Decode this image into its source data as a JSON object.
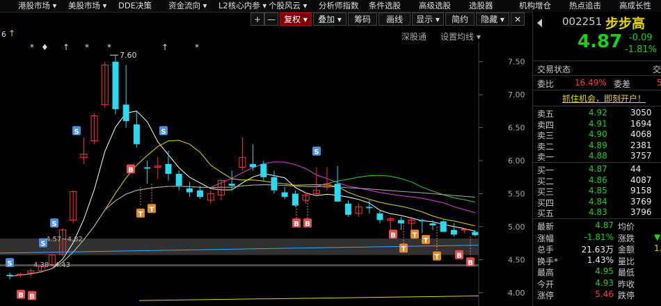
{
  "top_menu": [
    "港股市场 ▾",
    "美股市场 ▾",
    "DDE决策",
    "资金流向 ▾",
    "L2核心内参 ▾",
    "个股风云 ▾",
    "分析师指数",
    "条件选股",
    "高级选股",
    "选股器",
    "机构增仓",
    "热点追击",
    "高成长性"
  ],
  "corner_marks": {
    "left_six": "6",
    "arrow": "↑"
  },
  "toolbar": {
    "plus": "+",
    "minus": "—",
    "fuquan": "复权 ▾",
    "diejia": "叠加 ▾",
    "chouma": "筹码",
    "huaxian": "画线",
    "xianshi": "显示 ▾",
    "jianyue": "简约",
    "yincang": "隐藏 ▾",
    "close": "✕"
  },
  "subtoolbar": {
    "shengu": "深股通",
    "ma_setting": "设置均线 ▾"
  },
  "chart": {
    "y_ticks": [
      "7.50",
      "7.00",
      "6.50",
      "6.00",
      "5.50",
      "5.00",
      "4.50",
      "4.00"
    ],
    "peak_label": "7.60",
    "range_label_1": "4.57~4.82",
    "range_label_2": "4.38~4.43",
    "star_mark": "*",
    "diamond_mark": "♦",
    "arrow_mark": "↑",
    "sig_S": "S",
    "sig_B": "B",
    "sig_T": "T"
  },
  "chart_data": {
    "type": "candlestick",
    "y_range": [
      3.85,
      7.75
    ],
    "candles": [
      {
        "o": 4.27,
        "h": 4.3,
        "l": 4.2,
        "c": 4.25
      },
      {
        "o": 4.27,
        "h": 4.31,
        "l": 4.23,
        "c": 4.28
      },
      {
        "o": 4.3,
        "h": 4.36,
        "l": 4.25,
        "c": 4.33
      },
      {
        "o": 4.33,
        "h": 4.42,
        "l": 4.3,
        "c": 4.4
      },
      {
        "o": 4.42,
        "h": 4.58,
        "l": 4.4,
        "c": 4.57
      },
      {
        "o": 4.58,
        "h": 4.98,
        "l": 4.55,
        "c": 4.95
      },
      {
        "o": 5.1,
        "h": 5.55,
        "l": 5.05,
        "c": 5.53
      },
      {
        "o": 6.05,
        "h": 6.35,
        "l": 5.95,
        "c": 6.1
      },
      {
        "o": 6.3,
        "h": 6.72,
        "l": 6.25,
        "c": 6.68
      },
      {
        "o": 6.85,
        "h": 7.5,
        "l": 6.8,
        "c": 7.45
      },
      {
        "o": 7.5,
        "h": 7.6,
        "l": 6.7,
        "c": 6.78
      },
      {
        "o": 6.85,
        "h": 7.45,
        "l": 6.5,
        "c": 6.6
      },
      {
        "o": 6.55,
        "h": 6.75,
        "l": 6.2,
        "c": 6.25
      },
      {
        "o": 5.9,
        "h": 6.0,
        "l": 5.65,
        "c": 5.88
      },
      {
        "o": 5.9,
        "h": 6.05,
        "l": 5.72,
        "c": 5.92
      },
      {
        "o": 5.95,
        "h": 6.15,
        "l": 5.7,
        "c": 5.8
      },
      {
        "o": 5.8,
        "h": 5.85,
        "l": 5.55,
        "c": 5.62
      },
      {
        "o": 5.58,
        "h": 5.68,
        "l": 5.45,
        "c": 5.52
      },
      {
        "o": 5.55,
        "h": 5.62,
        "l": 5.42,
        "c": 5.45
      },
      {
        "o": 5.4,
        "h": 5.55,
        "l": 5.35,
        "c": 5.5
      },
      {
        "o": 5.48,
        "h": 5.72,
        "l": 5.4,
        "c": 5.7
      },
      {
        "o": 5.65,
        "h": 5.85,
        "l": 5.55,
        "c": 5.62
      },
      {
        "o": 5.9,
        "h": 6.35,
        "l": 5.85,
        "c": 6.05
      },
      {
        "o": 5.95,
        "h": 6.25,
        "l": 5.85,
        "c": 5.9
      },
      {
        "o": 5.95,
        "h": 6.0,
        "l": 5.7,
        "c": 5.75
      },
      {
        "o": 5.75,
        "h": 5.85,
        "l": 5.5,
        "c": 5.55
      },
      {
        "o": 5.52,
        "h": 5.6,
        "l": 5.42,
        "c": 5.45
      },
      {
        "o": 5.5,
        "h": 5.55,
        "l": 5.3,
        "c": 5.32
      },
      {
        "o": 5.4,
        "h": 5.52,
        "l": 5.35,
        "c": 5.48
      },
      {
        "o": 5.5,
        "h": 5.9,
        "l": 5.48,
        "c": 5.55
      },
      {
        "o": 5.6,
        "h": 5.9,
        "l": 5.55,
        "c": 5.65
      },
      {
        "o": 5.65,
        "h": 5.92,
        "l": 5.4,
        "c": 5.38
      },
      {
        "o": 5.35,
        "h": 5.4,
        "l": 5.15,
        "c": 5.18
      },
      {
        "o": 5.2,
        "h": 5.35,
        "l": 5.15,
        "c": 5.3
      },
      {
        "o": 5.3,
        "h": 5.4,
        "l": 5.2,
        "c": 5.28
      },
      {
        "o": 5.2,
        "h": 5.25,
        "l": 5.05,
        "c": 5.1
      },
      {
        "o": 5.1,
        "h": 5.15,
        "l": 4.9,
        "c": 5.12
      },
      {
        "o": 5.1,
        "h": 5.15,
        "l": 4.95,
        "c": 5.05
      },
      {
        "o": 5.05,
        "h": 5.15,
        "l": 4.95,
        "c": 5.1
      },
      {
        "o": 5.1,
        "h": 5.12,
        "l": 4.9,
        "c": 5.08
      },
      {
        "o": 5.05,
        "h": 5.1,
        "l": 4.95,
        "c": 5.02
      },
      {
        "o": 5.08,
        "h": 5.1,
        "l": 4.95,
        "c": 4.92
      },
      {
        "o": 4.95,
        "h": 5.05,
        "l": 4.85,
        "c": 4.88
      },
      {
        "o": 4.95,
        "h": 4.98,
        "l": 4.9,
        "c": 4.96
      },
      {
        "o": 4.92,
        "h": 4.95,
        "l": 4.85,
        "c": 4.87
      }
    ]
  },
  "quote": {
    "code": "002251",
    "name": "步步高",
    "price": "4.87",
    "change": "-0.09",
    "change_pct": "-1.81%",
    "trade_status_label": "交易状态",
    "trade_status_right": "交",
    "weibi_label": "委比",
    "weibi_value": "16.49%",
    "weicha_label": "委差",
    "weicha_value": "5",
    "promo": "抓住机会，即刻开户！"
  },
  "order_book": {
    "asks": [
      {
        "label": "卖五",
        "price": "4.92",
        "vol": "3050"
      },
      {
        "label": "卖四",
        "price": "4.91",
        "vol": "1694"
      },
      {
        "label": "卖三",
        "price": "4.90",
        "vol": "4068"
      },
      {
        "label": "卖二",
        "price": "4.89",
        "vol": "2381"
      },
      {
        "label": "卖一",
        "price": "4.88",
        "vol": "3757"
      }
    ],
    "bids": [
      {
        "label": "买一",
        "price": "4.87",
        "vol": "44"
      },
      {
        "label": "买二",
        "price": "4.86",
        "vol": "4087"
      },
      {
        "label": "买三",
        "price": "4.85",
        "vol": "9158"
      },
      {
        "label": "买四",
        "price": "4.84",
        "vol": "3769"
      },
      {
        "label": "买五",
        "price": "4.83",
        "vol": "3796"
      }
    ]
  },
  "stats": [
    {
      "l1": "最新",
      "v1": "4.87",
      "c1": "green",
      "l2": "均价",
      "v2": "",
      "c2": "white"
    },
    {
      "l1": "涨幅",
      "v1": "-1.81%",
      "c1": "green",
      "l2": "涨跌",
      "v2": "▼",
      "c2": "green"
    },
    {
      "l1": "总手",
      "v1": "21.63万",
      "c1": "white",
      "l2": "金额",
      "v2": "1.",
      "c2": "yellow"
    },
    {
      "l1": "换手*",
      "v1": "1.43%",
      "c1": "white",
      "l2": "量比",
      "v2": "",
      "c2": "white"
    },
    {
      "l1": "最高",
      "v1": "4.95",
      "c1": "green",
      "l2": "最低",
      "v2": "",
      "c2": "white"
    },
    {
      "l1": "今开",
      "v1": "4.93",
      "c1": "green",
      "l2": "昨收",
      "v2": "",
      "c2": "white"
    },
    {
      "l1": "涨停",
      "v1": "5.46",
      "c1": "red",
      "l2": "跌停",
      "v2": "",
      "c2": "white"
    }
  ]
}
